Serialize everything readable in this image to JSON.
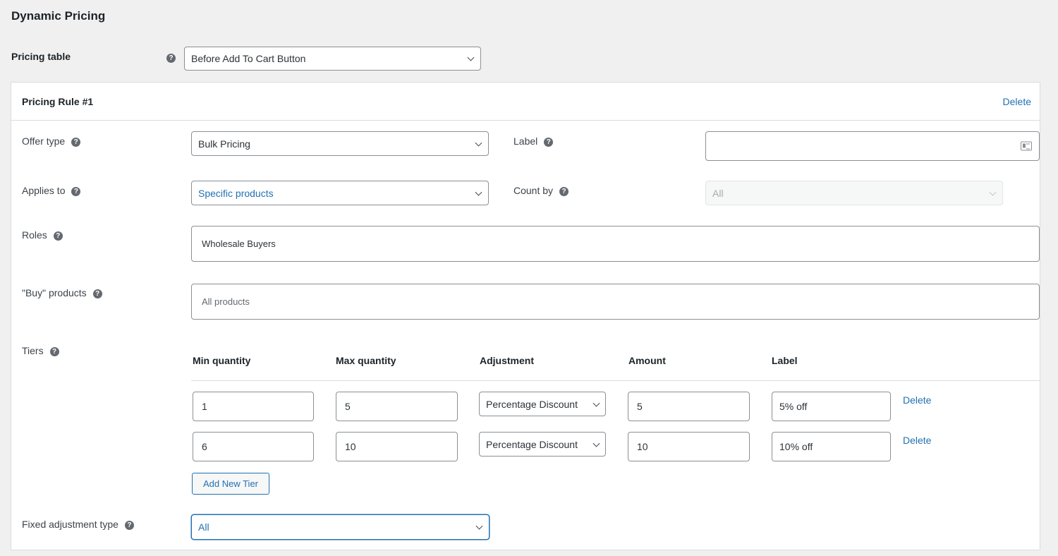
{
  "page": {
    "title": "Dynamic Pricing"
  },
  "pricing_table": {
    "label": "Pricing table",
    "value": "Before Add To Cart Button"
  },
  "rule": {
    "title": "Pricing Rule #1",
    "delete_label": "Delete",
    "offer_type": {
      "label": "Offer type",
      "value": "Bulk Pricing"
    },
    "label_field": {
      "label": "Label",
      "value": ""
    },
    "applies_to": {
      "label": "Applies to",
      "value": "Specific products"
    },
    "count_by": {
      "label": "Count by",
      "value": "All"
    },
    "roles": {
      "label": "Roles",
      "value": "Wholesale Buyers"
    },
    "buy_products": {
      "label": "\"Buy\" products",
      "placeholder": "All products"
    },
    "tiers": {
      "label": "Tiers",
      "headers": [
        "Min quantity",
        "Max quantity",
        "Adjustment",
        "Amount",
        "Label"
      ],
      "rows": [
        {
          "min": "1",
          "max": "5",
          "adjustment": "Percentage Discount",
          "amount": "5",
          "label": "5% off",
          "delete_label": "Delete"
        },
        {
          "min": "6",
          "max": "10",
          "adjustment": "Percentage Discount",
          "amount": "10",
          "label": "10% off",
          "delete_label": "Delete"
        }
      ],
      "add_button": "Add New Tier"
    },
    "fixed_adjustment_type": {
      "label": "Fixed adjustment type",
      "value": "All"
    }
  },
  "icons": {
    "help": "?"
  },
  "colors": {
    "accent": "#2271b1",
    "background": "#f0f0f1",
    "help_icon": "#646970"
  }
}
